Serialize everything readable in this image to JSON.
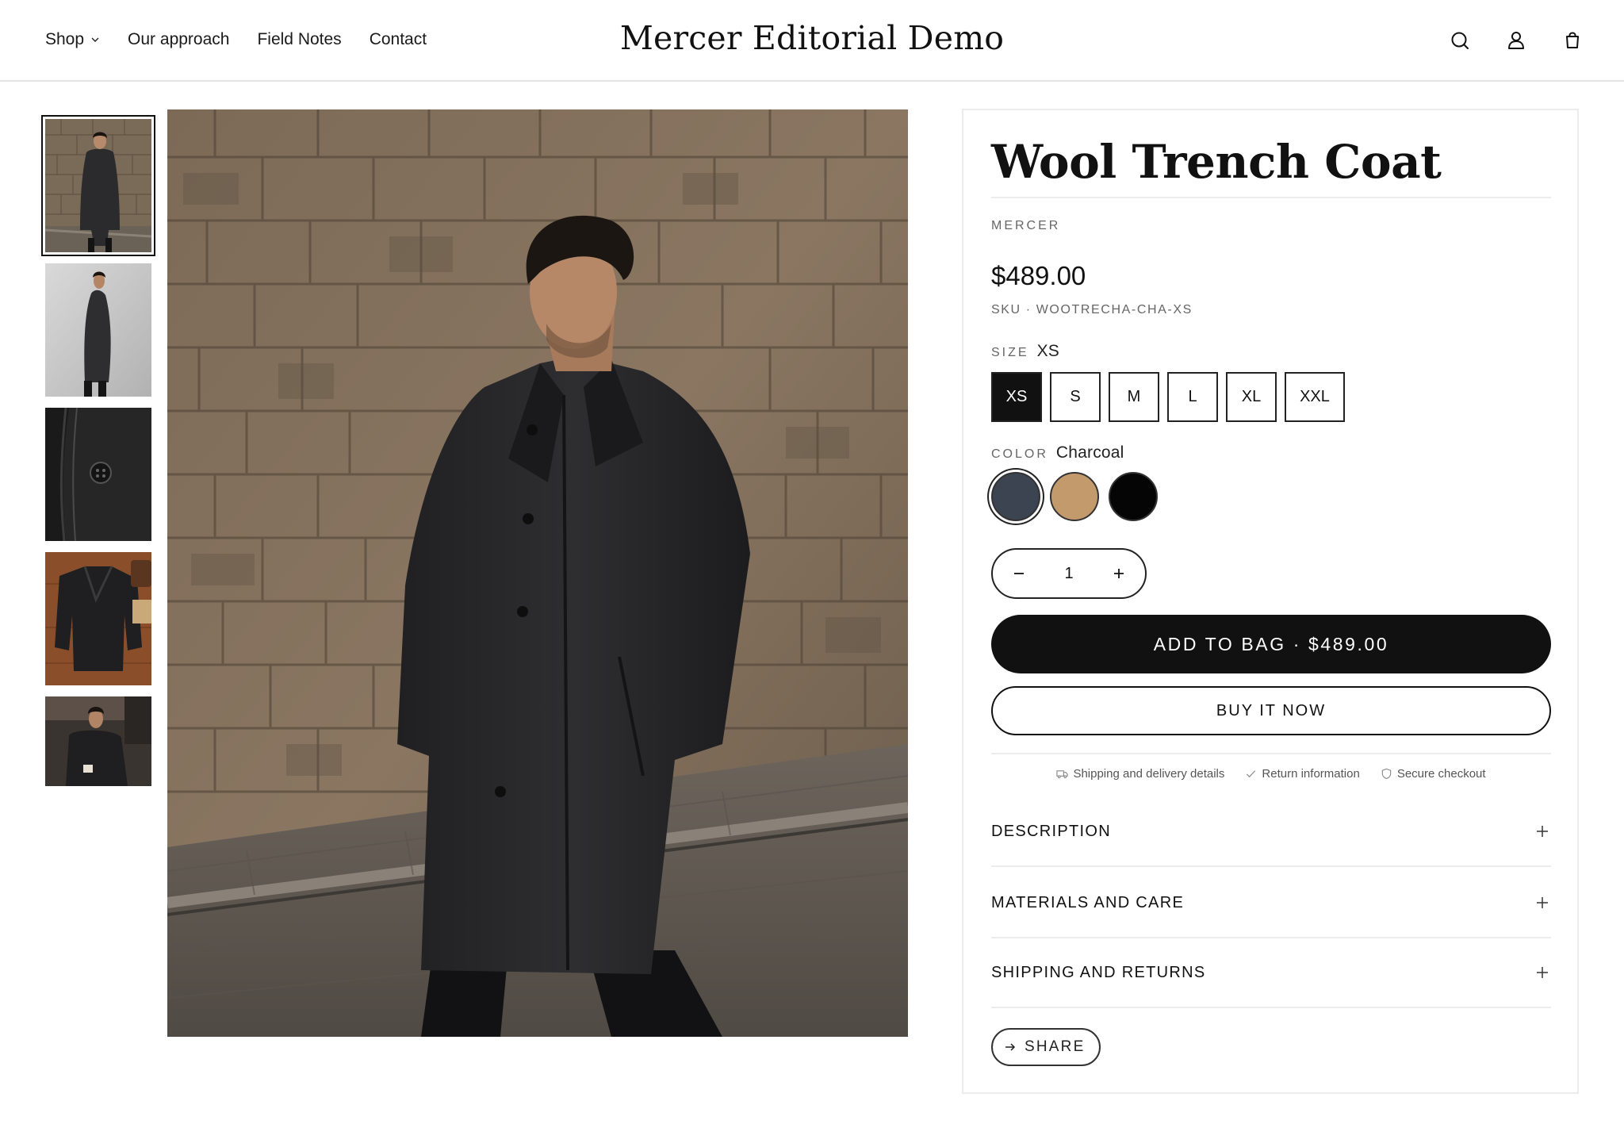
{
  "header": {
    "nav": [
      {
        "label": "Shop",
        "has_dropdown": true
      },
      {
        "label": "Our approach"
      },
      {
        "label": "Field Notes"
      },
      {
        "label": "Contact"
      }
    ],
    "brand": "Mercer Editorial Demo",
    "icons": [
      "search-icon",
      "account-icon",
      "bag-icon"
    ]
  },
  "gallery": {
    "thumbnails": [
      {
        "icon": "coat-front-photo",
        "active": true
      },
      {
        "icon": "coat-side-photo"
      },
      {
        "icon": "coat-button-detail-photo"
      },
      {
        "icon": "coat-flatlay-photo"
      },
      {
        "icon": "coat-seated-photo"
      }
    ],
    "main_image": "man-in-charcoal-wool-coat-photo"
  },
  "product": {
    "title": "Wool Trench Coat",
    "vendor": "MERCER",
    "price": "$489.00",
    "sku": "SKU · WOOTRECHA-CHA-XS",
    "size": {
      "label": "SIZE",
      "selected": "XS",
      "options": [
        "XS",
        "S",
        "M",
        "L",
        "XL",
        "XXL"
      ]
    },
    "color": {
      "label": "COLOR",
      "selected": "Charcoal",
      "swatches": [
        {
          "name": "Charcoal",
          "hex": "#3b4450",
          "selected": true
        },
        {
          "name": "Camel",
          "hex": "#c39a6b"
        },
        {
          "name": "Black",
          "hex": "#050505"
        }
      ]
    },
    "quantity": "1",
    "add_to_bag": "ADD TO BAG · $489.00",
    "buy_now": "BUY IT NOW",
    "trust": [
      {
        "icon": "truck-icon",
        "label": "Shipping and delivery details"
      },
      {
        "icon": "check-icon",
        "label": "Return information"
      },
      {
        "icon": "shield-icon",
        "label": "Secure checkout"
      }
    ],
    "accordions": [
      {
        "label": "DESCRIPTION"
      },
      {
        "label": "MATERIALS AND CARE"
      },
      {
        "label": "SHIPPING AND RETURNS"
      }
    ],
    "share": "SHARE"
  },
  "colors": {
    "text": "#111111",
    "muted": "#666666",
    "border": "#ececec",
    "button": "#111111"
  }
}
